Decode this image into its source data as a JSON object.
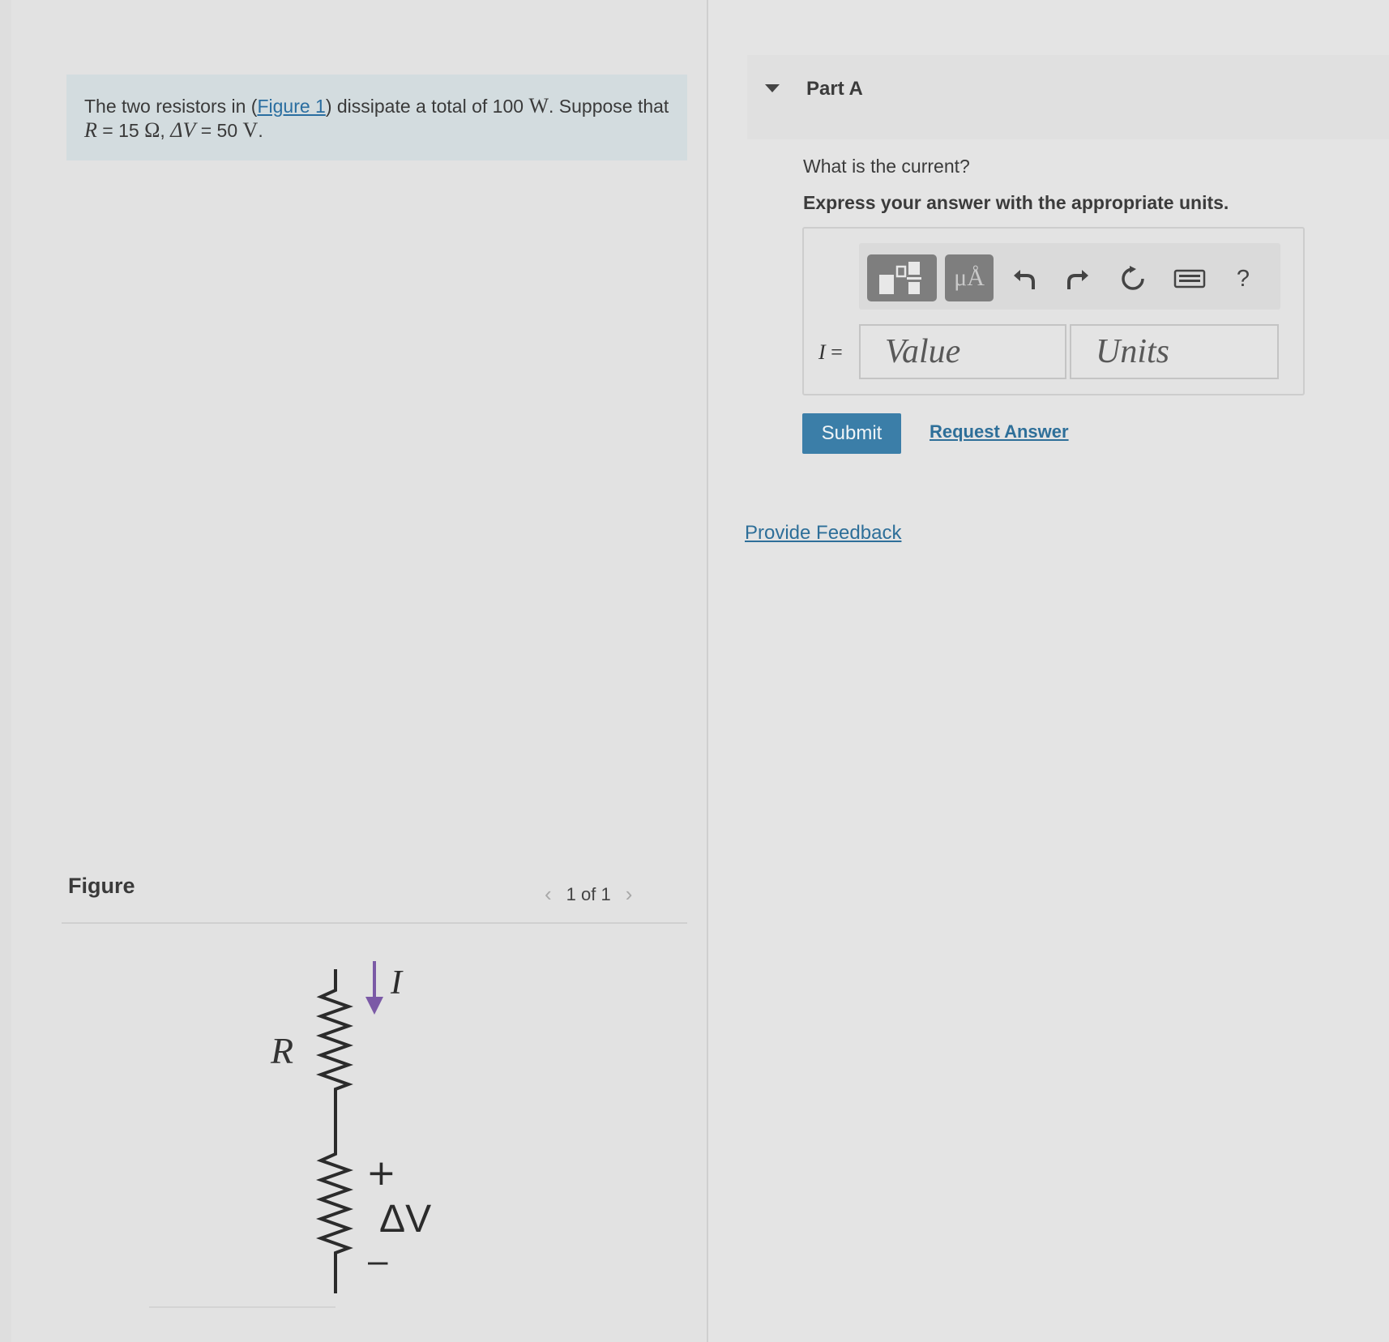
{
  "problem": {
    "text_before_link": "The two resistors in (",
    "figure_link": "Figure 1",
    "text_after_link": ") dissipate a total of 100 ",
    "watt_unit": "W",
    "text_suppose": ". Suppose that",
    "r_symbol": "R",
    "r_eq": " = 15 ",
    "ohm_unit": "Ω",
    "comma": ", ",
    "dv_symbol": "ΔV",
    "dv_eq": " = 50 ",
    "volt_unit": "V",
    "end": "."
  },
  "figure": {
    "heading": "Figure",
    "prev_icon": "chevron-left-icon",
    "next_icon": "chevron-right-icon",
    "counter": "1 of 1",
    "labels": {
      "current": "I",
      "resistor": "R",
      "plus": "+",
      "delta_v": "ΔV",
      "minus": "–"
    },
    "current_arrow_color": "#7b5aa6"
  },
  "part": {
    "toggle_icon": "caret-down-icon",
    "title": "Part A",
    "question": "What is the current?",
    "instruction": "Express your answer with the appropriate units.",
    "toolbar": {
      "templates_icon": "templates-icon",
      "units_label": "μÅ",
      "undo_icon": "undo-icon",
      "redo_icon": "redo-icon",
      "reset_icon": "reset-icon",
      "keyboard_icon": "keyboard-icon",
      "help_label": "?"
    },
    "answer": {
      "variable": "I",
      "equals": " =",
      "value_placeholder": "Value",
      "units_placeholder": "Units"
    },
    "submit_label": "Submit",
    "request_answer_label": "Request Answer"
  },
  "feedback_label": "Provide Feedback",
  "colors": {
    "link": "#2e6f99",
    "submit_bg": "#3b7ea8",
    "problem_bg": "#d3dcdf"
  }
}
